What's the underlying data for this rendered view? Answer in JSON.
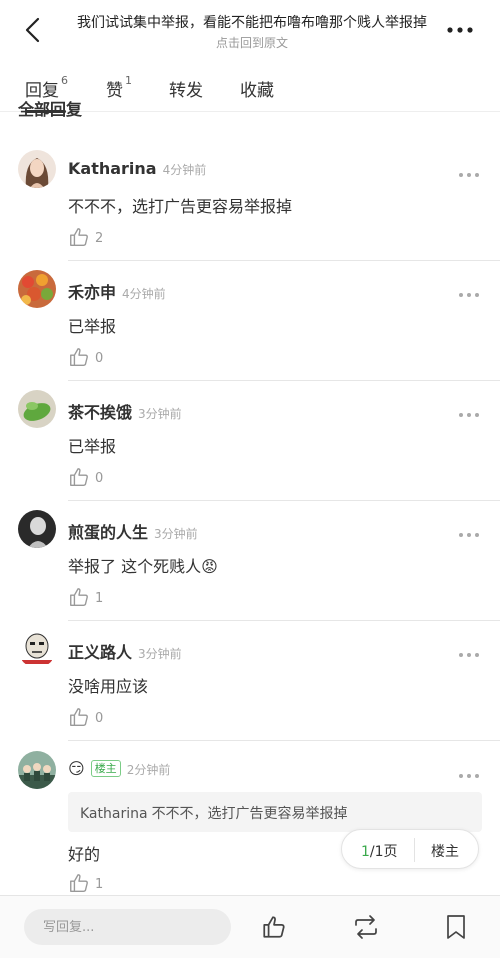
{
  "header": {
    "title": "我们试试集中举报，看能不能把布噜布噜那个贱人举报掉",
    "subtitle": "点击回到原文",
    "back_icon": "chevron-left-icon",
    "more_icon": "more-icon"
  },
  "tabs": [
    {
      "label": "回复",
      "count": "6",
      "active": true
    },
    {
      "label": "赞",
      "count": "1",
      "active": false
    },
    {
      "label": "转发",
      "count": "",
      "active": false
    },
    {
      "label": "收藏",
      "count": "",
      "active": false
    }
  ],
  "section_title": "全部回复",
  "comments": [
    {
      "name": "Katharina",
      "time": "4分钟前",
      "text": "不不不，选打广告更容易举报掉",
      "likes": "2"
    },
    {
      "name": "禾亦申",
      "time": "4分钟前",
      "text": "已举报",
      "likes": "0"
    },
    {
      "name": "茶不挨饿",
      "time": "3分钟前",
      "text": "已举报",
      "likes": "0"
    },
    {
      "name": "煎蛋的人生",
      "time": "3分钟前",
      "text": "举报了 这个死贱人😡",
      "likes": "1"
    },
    {
      "name": "正义路人",
      "time": "3分钟前",
      "text": "没啥用应该",
      "likes": "0"
    },
    {
      "name": "😏",
      "owner_tag": "楼主",
      "time": "2分钟前",
      "quote_name": "Katharina",
      "quote_text": "不不不，选打广告更容易举报掉",
      "text": "好的",
      "likes": "1"
    }
  ],
  "pager": {
    "current": "1",
    "total": "/1页",
    "floor_label": "楼主"
  },
  "bottom_bar": {
    "reply_placeholder": "写回复...",
    "icons": [
      "thumbs-up-icon",
      "repost-icon",
      "bookmark-icon"
    ]
  },
  "colors": {
    "accent_green": "#3aa94c",
    "divider": "#e6e6e6"
  }
}
